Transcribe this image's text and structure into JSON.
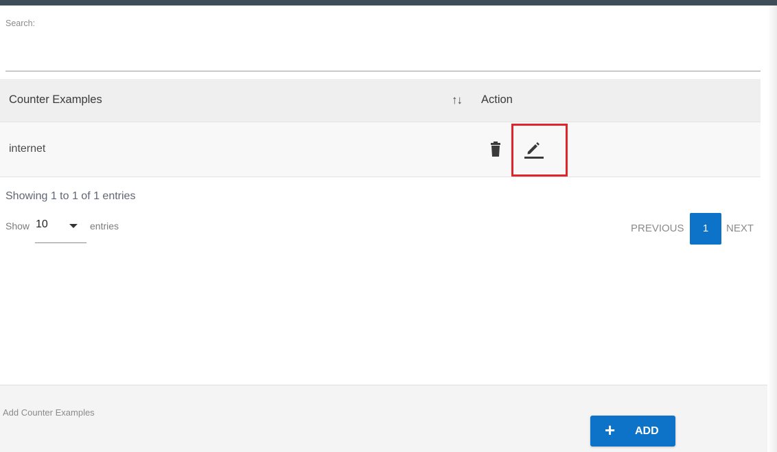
{
  "search": {
    "label": "Search:",
    "value": "",
    "placeholder": ""
  },
  "table": {
    "columns": [
      "Counter Examples",
      "Action"
    ],
    "sort_icon": "↑↓",
    "rows": [
      {
        "counter_example": "internet"
      }
    ]
  },
  "pagination": {
    "info": "Showing 1 to 1 of 1 entries",
    "show_label": "Show",
    "page_size": "10",
    "entries_label": "entries",
    "previous": "PREVIOUS",
    "current_page": "1",
    "next": "NEXT"
  },
  "footer": {
    "label": "Add Counter Examples",
    "add_button": "ADD",
    "add_icon": "+"
  },
  "icons": {
    "delete": "trash-icon",
    "edit": "pencil-icon",
    "sort": "sort-icon",
    "dropdown": "caret-down-icon"
  },
  "colors": {
    "primary": "#0c73c9",
    "highlight": "#e1242a",
    "topbar": "#3f4d59"
  }
}
